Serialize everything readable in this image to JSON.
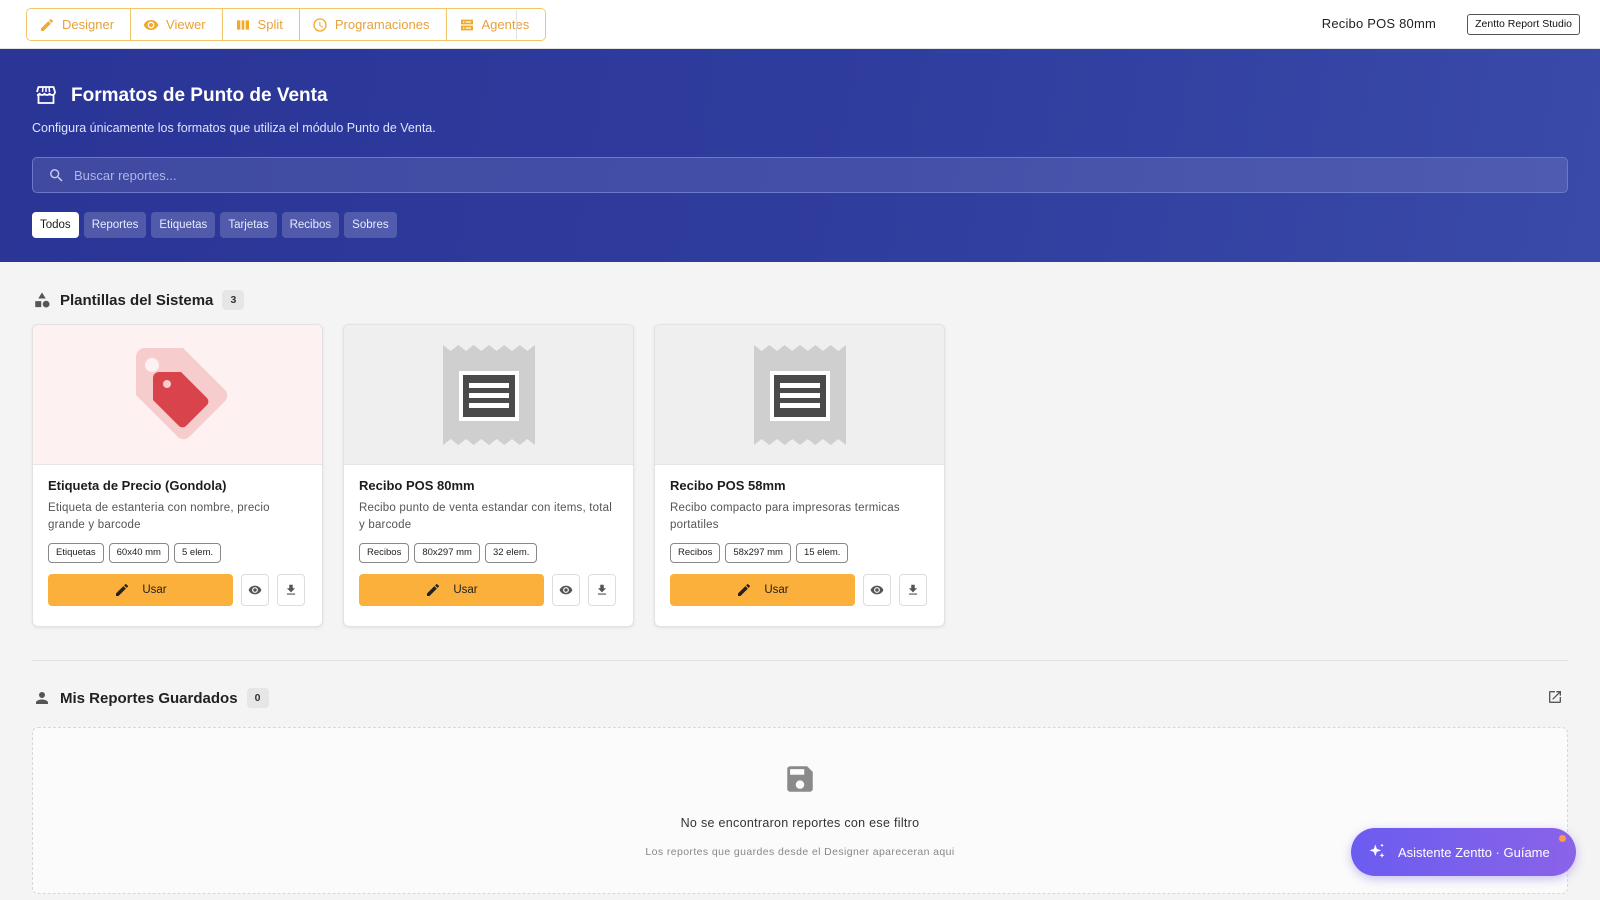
{
  "toolbar": {
    "modes": [
      {
        "label": "Designer",
        "icon": "pencil-icon"
      },
      {
        "label": "Viewer",
        "icon": "eye-icon"
      },
      {
        "label": "Split",
        "icon": "columns-icon"
      },
      {
        "label": "Programaciones",
        "icon": "clock-icon"
      },
      {
        "label": "Agentes",
        "icon": "server-icon"
      }
    ],
    "doc_title": "Recibo POS 80mm",
    "studio_label": "Zentto Report Studio",
    "accent_color": "#f0a928"
  },
  "hero": {
    "title": "Formatos de Punto de Venta",
    "subtitle": "Configura únicamente los formatos que utiliza el módulo Punto de Venta.",
    "search_placeholder": "Buscar reportes...",
    "filters": [
      "Todos",
      "Reportes",
      "Etiquetas",
      "Tarjetas",
      "Recibos",
      "Sobres"
    ],
    "active_filter": "Todos",
    "background_color": "#2f3d9e"
  },
  "templates_section": {
    "title": "Plantillas del Sistema",
    "count": "3",
    "cards": [
      {
        "title": "Etiqueta de Precio (Gondola)",
        "description": "Etiqueta de estanteria con nombre, precio grande y barcode",
        "tags": [
          "Etiquetas",
          "60x40 mm",
          "5 elem."
        ],
        "thumb_icon": "price-tag-icon",
        "use_label": "Usar"
      },
      {
        "title": "Recibo POS 80mm",
        "description": "Recibo punto de venta estandar con items, total y barcode",
        "tags": [
          "Recibos",
          "80x297 mm",
          "32 elem."
        ],
        "thumb_icon": "receipt-icon",
        "use_label": "Usar"
      },
      {
        "title": "Recibo POS 58mm",
        "description": "Recibo compacto para impresoras termicas portatiles",
        "tags": [
          "Recibos",
          "58x297 mm",
          "15 elem."
        ],
        "thumb_icon": "receipt-icon",
        "use_label": "Usar"
      }
    ],
    "button_color": "#fbb03b"
  },
  "saved_section": {
    "title": "Mis Reportes Guardados",
    "count": "0",
    "empty_title": "No se encontraron reportes con ese filtro",
    "empty_subtitle": "Los reportes que guardes desde el Designer apareceran aqui"
  },
  "assistant": {
    "label": "Asistente Zentto · Guíame",
    "color": "#7a5ff0"
  }
}
